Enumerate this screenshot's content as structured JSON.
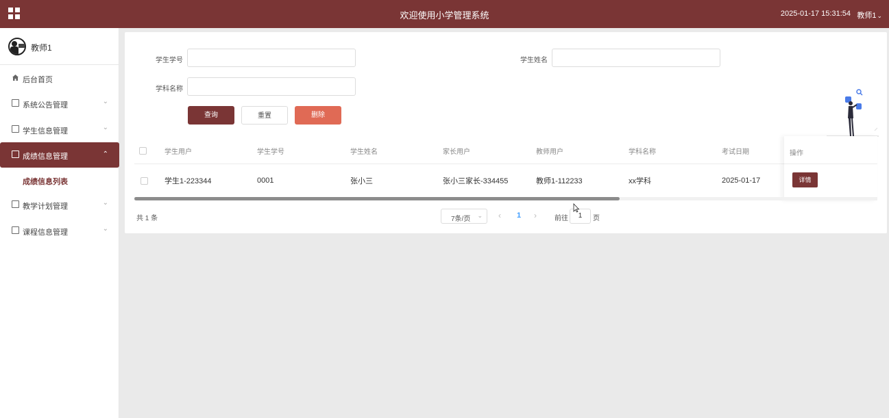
{
  "header": {
    "title": "欢迎使用小学管理系统",
    "datetime": "2025-01-17 15:31:54",
    "user": "教师1"
  },
  "sidebar": {
    "profile_name": "教师1",
    "items": [
      {
        "label": "后台首页",
        "icon": "home-icon"
      },
      {
        "label": "系统公告管理",
        "icon": "document-icon"
      },
      {
        "label": "学生信息管理",
        "icon": "document-icon"
      },
      {
        "label": "成绩信息管理",
        "icon": "document-icon",
        "active": true
      },
      {
        "label": "教学计划管理",
        "icon": "document-icon"
      },
      {
        "label": "课程信息管理",
        "icon": "document-icon"
      }
    ],
    "sub_item": "成绩信息列表"
  },
  "filters": {
    "student_no_label": "学生学号",
    "student_no_value": "",
    "student_name_label": "学生姓名",
    "student_name_value": "",
    "subject_label": "学科名称",
    "subject_value": ""
  },
  "buttons": {
    "query": "查询",
    "reset": "重置",
    "delete": "删除",
    "detail": "详情"
  },
  "table": {
    "headers": [
      "学生用户",
      "学生学号",
      "学生姓名",
      "家长用户",
      "教师用户",
      "学科名称",
      "考试日期",
      "操作"
    ],
    "rows": [
      [
        "学生1-223344",
        "0001",
        "张小三",
        "张小三家长-334455",
        "教师1-112233",
        "xx学科",
        "2025-01-17"
      ]
    ]
  },
  "pagination": {
    "total": "共 1 条",
    "page_size": "7条/页",
    "current_page": "1",
    "goto_label": "前往",
    "goto_value": "1",
    "page_suffix": "页"
  },
  "colors": {
    "brand": "#7a3535",
    "delete": "#e06a55",
    "link": "#409eff"
  }
}
